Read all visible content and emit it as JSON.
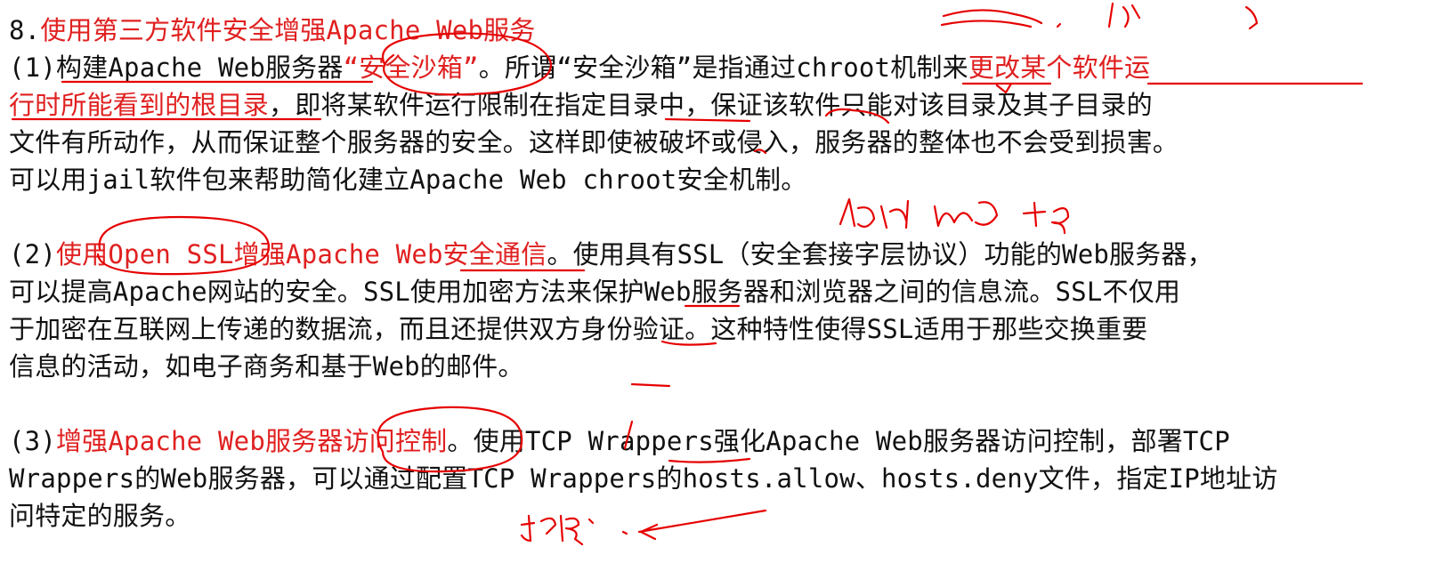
{
  "heading": {
    "number": "8.",
    "title": "使用第三方软件安全增强Apache Web服务"
  },
  "item1": {
    "line1_prefix": "(1)",
    "line1_red_a": "构建Apache Web服务器",
    "line1_quote": "“安全沙箱”",
    "line1_black": "。所谓“安全沙箱”是指通过chroot机制来",
    "line1_red_b": "更改某个软件运",
    "line2_red": "行时所能看到的根目录",
    "line2_black": "，即将某软件运行限制在指定目录中，保证该软件只能对该目录及其子目录的",
    "line3": "文件有所动作，从而保证整个服务器的安全。这样即使被破坏或侵入，服务器的整体也不会受到损害。",
    "line4": "可以用jail软件包来帮助简化建立Apache Web chroot安全机制。"
  },
  "item2": {
    "line1_prefix": "(2)",
    "line1_red": "使用Open SSL增强Apache Web安全通信",
    "line1_black": "。使用具有SSL（安全套接字层协议）功能的Web服务器，",
    "line2": "可以提高Apache网站的安全。SSL使用加密方法来保护Web服务器和浏览器之间的信息流。SSL不仅用",
    "line3": "于加密在互联网上传递的数据流，而且还提供双方身份验证。这种特性使得SSL适用于那些交换重要",
    "line4": "信息的活动，如电子商务和基于Web的邮件。"
  },
  "item3": {
    "line1_prefix": "(3)",
    "line1_red": "增强Apache Web服务器访问控制",
    "line1_black": "。使用TCP Wrappers强化Apache Web服务器访问控制，部署TCP",
    "line2": "Wrappers的Web服务器，可以通过配置TCP Wrappers的hosts.allow、hosts.deny文件，指定IP地址访",
    "line3": "问特定的服务。"
  },
  "annotation_color": "#e60000"
}
